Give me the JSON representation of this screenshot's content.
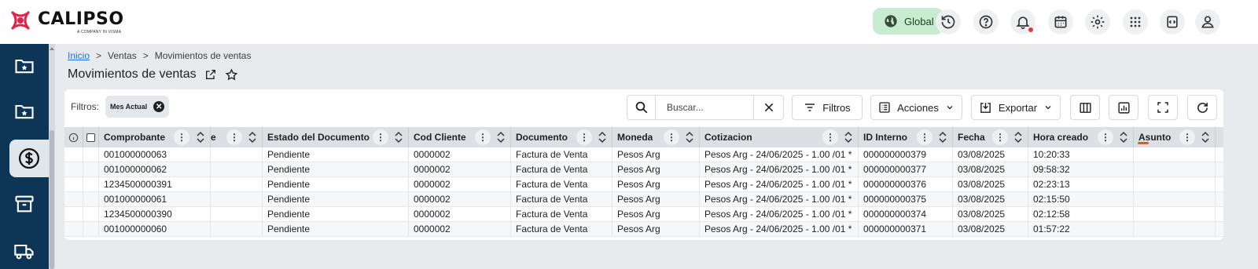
{
  "app": {
    "name": "CALIPSO",
    "tagline": "A COMPANY IN VISMA"
  },
  "topbar": {
    "global_label": "Global"
  },
  "breadcrumb": {
    "home": "Inicio",
    "section": "Ventas",
    "current": "Movimientos de ventas",
    "separator": ">"
  },
  "page": {
    "title": "Movimientos de ventas"
  },
  "filters": {
    "label": "Filtros:",
    "chip": "Mes Actual"
  },
  "search": {
    "placeholder": "Buscar..."
  },
  "toolbar": {
    "filtros": "Filtros",
    "acciones": "Acciones",
    "exportar": "Exportar"
  },
  "table": {
    "headers": [
      "Comprobante",
      "e",
      "Estado del Documento",
      "Cod Cliente",
      "Documento",
      "Moneda",
      "Cotizacion",
      "ID Interno",
      "Fecha",
      "Hora creado",
      "Asunto"
    ],
    "rows": [
      [
        "001000000063",
        "",
        "Pendiente",
        "0000002",
        "Factura de Venta",
        "Pesos Arg",
        "Pesos Arg - 24/06/2025 - 1.00 /01 *",
        "000000000379",
        "03/08/2025",
        "10:20:33",
        ""
      ],
      [
        "001000000062",
        "",
        "Pendiente",
        "0000002",
        "Factura de Venta",
        "Pesos Arg",
        "Pesos Arg - 24/06/2025 - 1.00 /01 *",
        "000000000377",
        "03/08/2025",
        "09:58:32",
        ""
      ],
      [
        "1234500000391",
        "",
        "Pendiente",
        "0000002",
        "Factura de Venta",
        "Pesos Arg",
        "Pesos Arg - 24/06/2025 - 1.00 /01 *",
        "000000000376",
        "03/08/2025",
        "02:23:13",
        ""
      ],
      [
        "001000000061",
        "",
        "Pendiente",
        "0000002",
        "Factura de Venta",
        "Pesos Arg",
        "Pesos Arg - 24/06/2025 - 1.00 /01 *",
        "000000000375",
        "03/08/2025",
        "02:15:50",
        ""
      ],
      [
        "1234500000390",
        "",
        "Pendiente",
        "0000002",
        "Factura de Venta",
        "Pesos Arg",
        "Pesos Arg - 24/06/2025 - 1.00 /01 *",
        "000000000374",
        "03/08/2025",
        "02:12:58",
        ""
      ],
      [
        "001000000060",
        "",
        "Pendiente",
        "0000002",
        "Factura de Venta",
        "Pesos Arg",
        "Pesos Arg - 24/06/2025 - 1.00 /01 *",
        "000000000371",
        "03/08/2025",
        "01:57:22",
        ""
      ]
    ]
  },
  "colors": {
    "sidebar": "#0c3556",
    "global_pill": "#c8ecd0",
    "link": "#1a73e8",
    "notification": "#e53935",
    "accent_underline": "#e2581a"
  }
}
